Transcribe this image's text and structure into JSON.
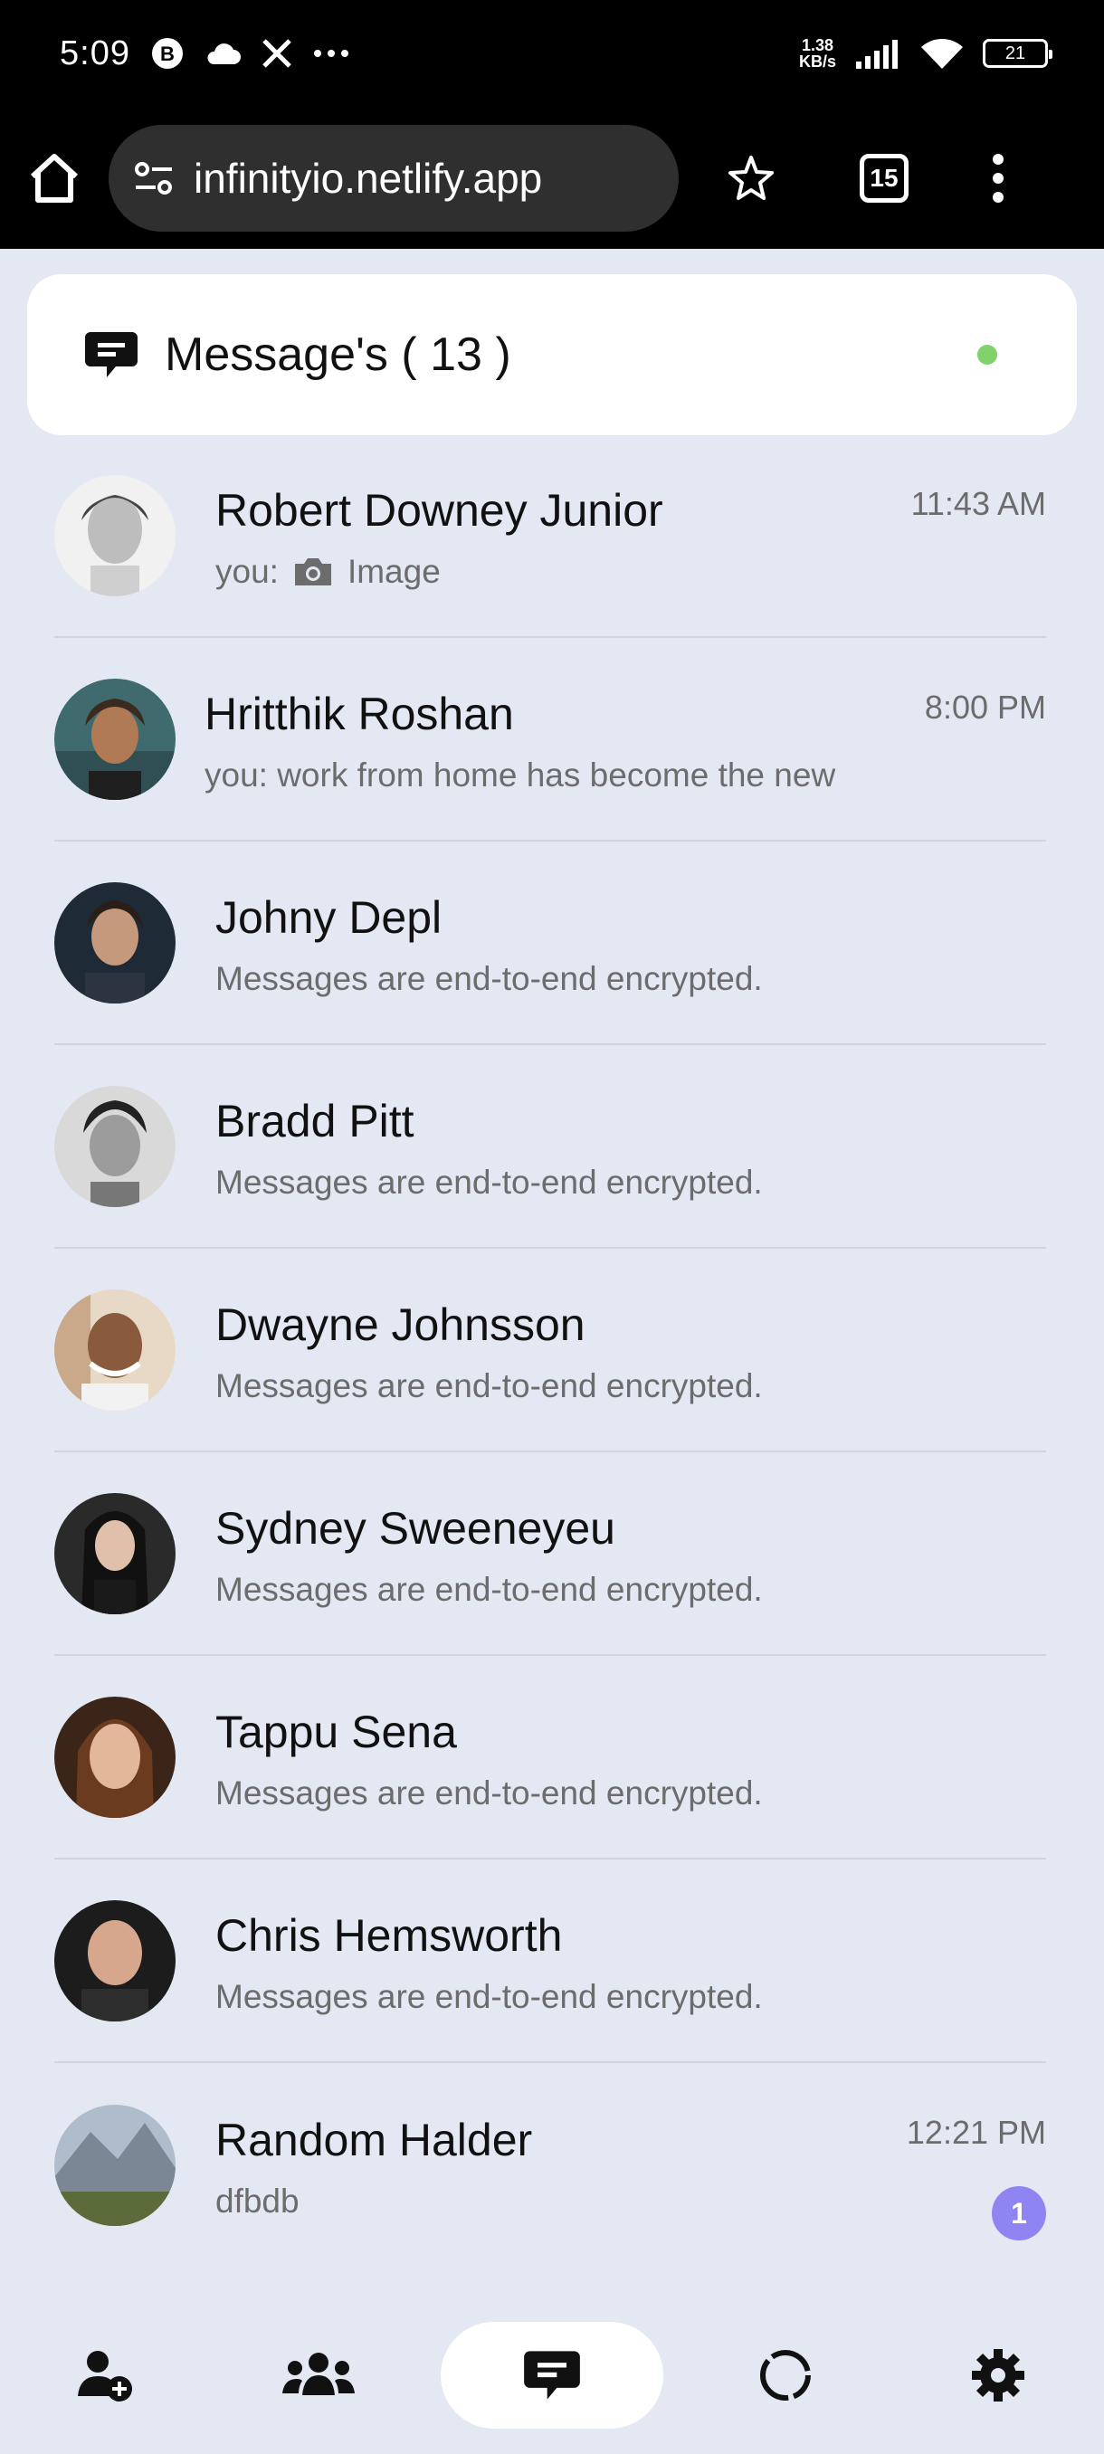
{
  "status_bar": {
    "time": "5:09",
    "speed": "1.38",
    "speed_unit": "KB/s",
    "battery": "21"
  },
  "browser": {
    "url": "infinityio.netlify.app",
    "tab_count": "15"
  },
  "header": {
    "title": "Message's ( 13 )",
    "online_color": "#7fd36a"
  },
  "chats": [
    {
      "name": "Robert Downey Junior",
      "preview_prefix": "you:",
      "preview": "Image",
      "time": "11:43 AM"
    },
    {
      "name": "Hritthik Roshan",
      "preview": "you: work from home has become the new",
      "time": "8:00 PM"
    },
    {
      "name": "Johny Depl",
      "preview": "Messages are end-to-end encrypted."
    },
    {
      "name": "Bradd Pitt",
      "preview": "Messages are end-to-end encrypted."
    },
    {
      "name": "Dwayne Johnsson",
      "preview": "Messages are end-to-end encrypted."
    },
    {
      "name": "Sydney Sweeneyeu",
      "preview": "Messages are end-to-end encrypted."
    },
    {
      "name": "Tappu Sena",
      "preview": "Messages are end-to-end encrypted."
    },
    {
      "name": "Chris Hemsworth",
      "preview": "Messages are end-to-end encrypted."
    },
    {
      "name": "Random Halder",
      "preview": "dfbdb",
      "time": "12:21 PM",
      "unread": "1"
    }
  ],
  "bottom_nav": [
    "add-user-icon",
    "groups-icon",
    "messages-icon",
    "status-icon",
    "settings-icon"
  ],
  "colors": {
    "accent": "#8e84f2",
    "background": "#e3e8f2"
  }
}
